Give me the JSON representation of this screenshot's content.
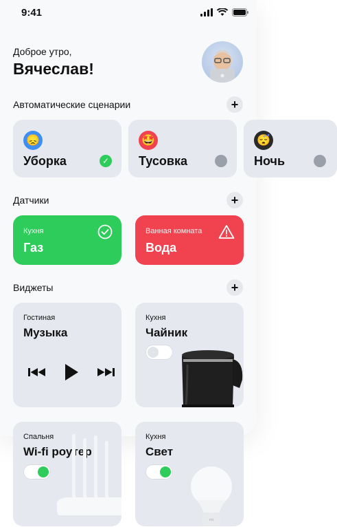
{
  "status": {
    "time": "9:41"
  },
  "header": {
    "greeting": "Доброе утро,",
    "name": "Вячеслав!"
  },
  "sections": {
    "scenarios": "Автоматические сценарии",
    "sensors": "Датчики",
    "widgets": "Виджеты"
  },
  "scenarios": [
    {
      "label": "Уборка",
      "emoji": "😞",
      "active": true
    },
    {
      "label": "Тусовка",
      "emoji": "🤩",
      "active": false
    },
    {
      "label": "Ночь",
      "emoji": "😴",
      "active": false
    }
  ],
  "sensors": [
    {
      "room": "Кухня",
      "value": "Газ",
      "status": "ok",
      "color": "#2ecc5a"
    },
    {
      "room": "Ванная комната",
      "value": "Вода",
      "status": "alert",
      "color": "#f0434f"
    }
  ],
  "widgets": [
    {
      "room": "Гостиная",
      "title": "Музыка"
    },
    {
      "room": "Кухня",
      "title": "Чайник",
      "on": false
    },
    {
      "room": "Спальня",
      "title": "Wi-fi роутер",
      "on": true
    },
    {
      "room": "Кухня",
      "title": "Свет",
      "on": true
    }
  ],
  "colors": {
    "green": "#2ecc5a",
    "red": "#f0434f",
    "card": "#e5e8ee"
  }
}
